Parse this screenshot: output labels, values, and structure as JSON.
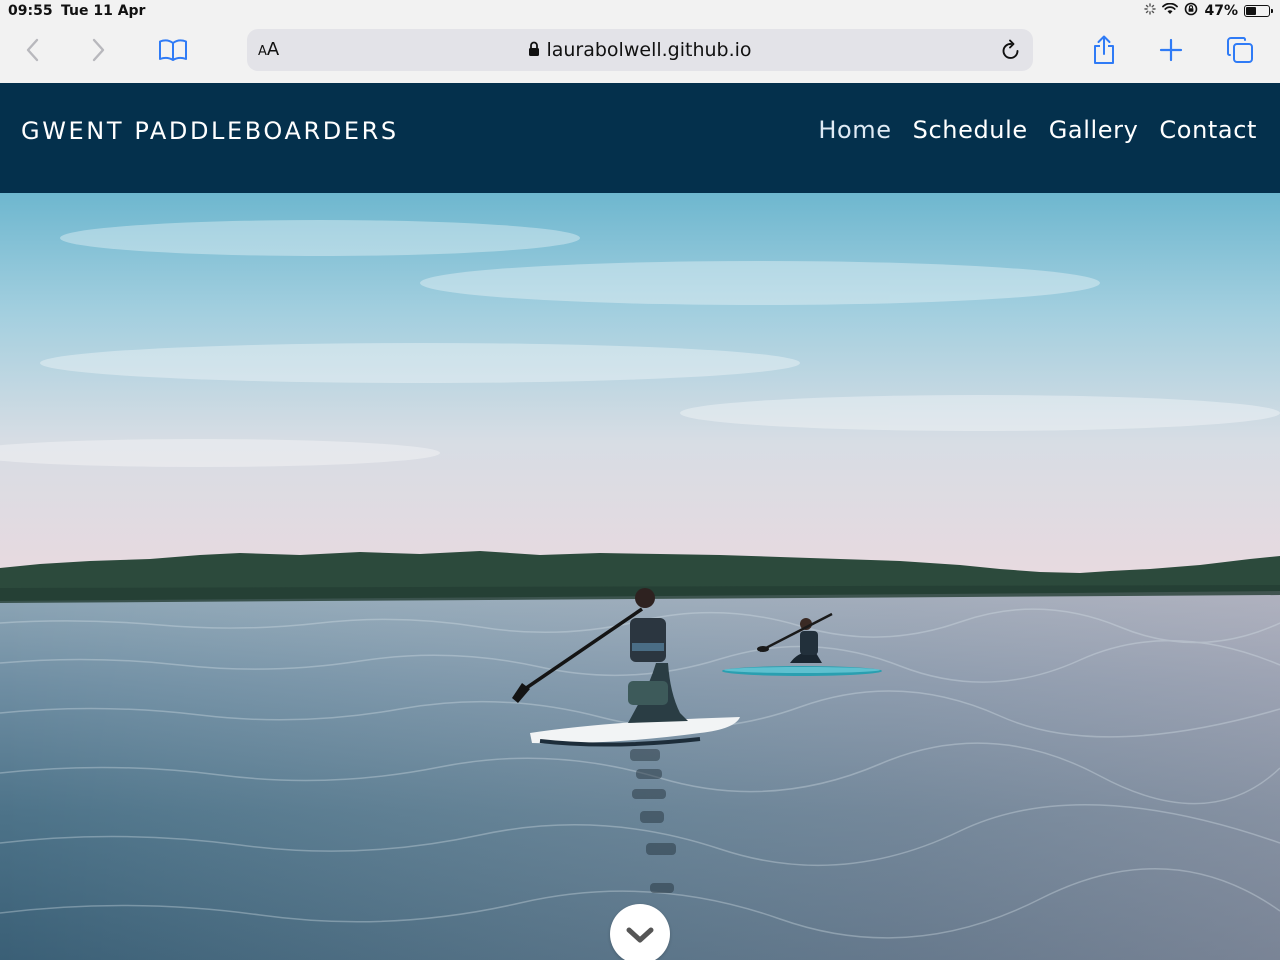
{
  "status_bar": {
    "time": "09:55",
    "date": "Tue 11 Apr",
    "battery_percent": "47%",
    "battery_level": 0.47,
    "icons": [
      "loading-spinner-icon",
      "wifi-icon",
      "orientation-lock-icon",
      "battery-icon"
    ]
  },
  "browser": {
    "text_size_label": "AA",
    "url": "laurabolwell.github.io",
    "icons": [
      "back-icon",
      "forward-icon",
      "bookmarks-icon",
      "lock-icon",
      "reload-icon",
      "share-icon",
      "new-tab-icon",
      "tabs-icon"
    ]
  },
  "site": {
    "brand": "GWENT PADDLEBOARDERS",
    "nav": [
      {
        "label": "Home",
        "active": true
      },
      {
        "label": "Schedule",
        "active": false
      },
      {
        "label": "Gallery",
        "active": false
      },
      {
        "label": "Contact",
        "active": false
      }
    ],
    "hero": {
      "image": "two paddleboarders kneeling on boards on a lake at dusk",
      "scroll_icon": "chevron-down-icon"
    }
  },
  "colors": {
    "nav_background": "#04304c",
    "nav_text": "#ffffff",
    "safari_accent": "#2f7bf6"
  }
}
